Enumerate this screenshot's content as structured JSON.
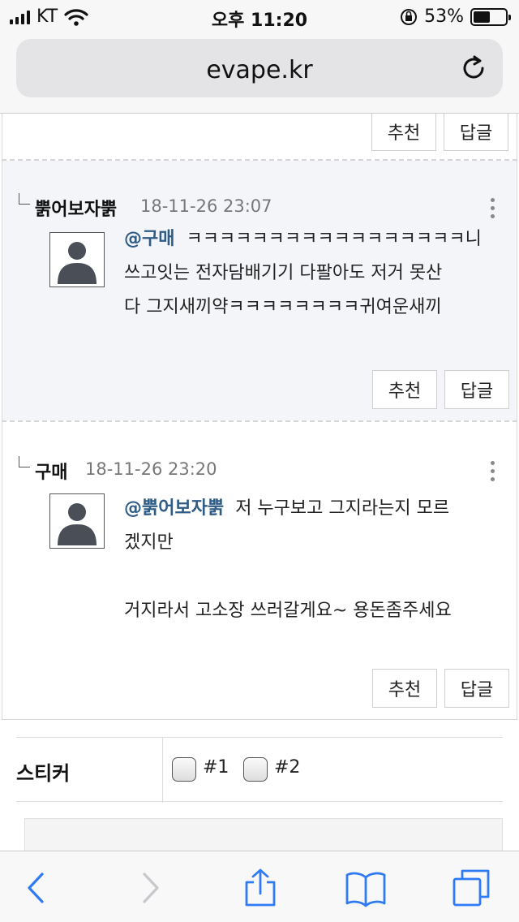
{
  "status_bar": {
    "carrier": "KT",
    "time": "오후 11:20",
    "battery": "53%",
    "battery_level": 0.53
  },
  "browser": {
    "url": "evape.kr"
  },
  "top_partial": {
    "recommend_label": "추천",
    "reply_label": "답글"
  },
  "comments": [
    {
      "author": "뿕어보자뿕",
      "date": "18-11-26 23:07",
      "mention": "@구매",
      "lines": [
        "ㅋㅋㅋㅋㅋㅋㅋㅋㅋㅋㅋㅋㅋㅋㅋㅋㅋ니",
        "쓰고잇는 전자담배기기 다팔아도 저거 못산",
        "다 그지새끼약ㅋㅋㅋㅋㅋㅋㅋㅋ귀여운새끼"
      ],
      "recommend_label": "추천",
      "reply_label": "답글"
    },
    {
      "author": "구매",
      "date": "18-11-26 23:20",
      "mention": "@뿕어보자뿕",
      "lines": [
        "저 누구보고 그지라는지 모르",
        "겠지만",
        "",
        "거지라서 고소장 쓰러갈게요~ 용돈좀주세요"
      ],
      "recommend_label": "추천",
      "reply_label": "답글"
    }
  ],
  "sticker": {
    "label": "스티커",
    "options": [
      "#1",
      "#2"
    ]
  },
  "colors": {
    "mention": "#2f5c86",
    "highlight_bg": "#f4f5f8",
    "link_blue": "#2f7bf6"
  }
}
